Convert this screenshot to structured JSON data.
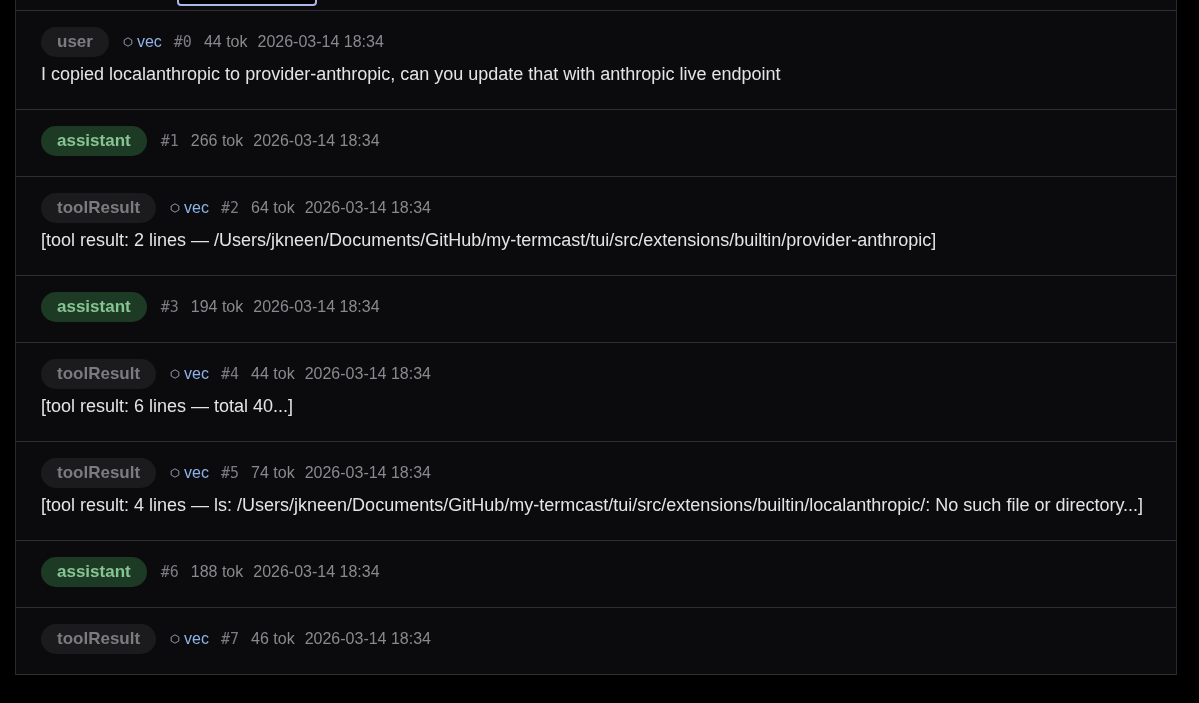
{
  "messages": [
    {
      "kind": "user",
      "role": "user",
      "vec_label": "vec",
      "index": "#0",
      "tokens": "44 tok",
      "time": "2026-03-14 18:34",
      "body": "I copied localanthropic to provider-anthropic, can you update that with anthropic live endpoint"
    },
    {
      "kind": "assistant",
      "role": "assistant",
      "index": "#1",
      "tokens": "266 tok",
      "time": "2026-03-14 18:34"
    },
    {
      "kind": "tool",
      "role": "toolResult",
      "vec_label": "vec",
      "index": "#2",
      "tokens": "64 tok",
      "time": "2026-03-14 18:34",
      "body": "[tool result: 2 lines — /Users/jkneen/Documents/GitHub/my-termcast/tui/src/extensions/builtin/provider-anthropic]"
    },
    {
      "kind": "assistant",
      "role": "assistant",
      "index": "#3",
      "tokens": "194 tok",
      "time": "2026-03-14 18:34"
    },
    {
      "kind": "tool",
      "role": "toolResult",
      "vec_label": "vec",
      "index": "#4",
      "tokens": "44 tok",
      "time": "2026-03-14 18:34",
      "body": "[tool result: 6 lines — total 40...]"
    },
    {
      "kind": "tool",
      "role": "toolResult",
      "vec_label": "vec",
      "index": "#5",
      "tokens": "74 tok",
      "time": "2026-03-14 18:34",
      "body": "[tool result: 4 lines — ls: /Users/jkneen/Documents/GitHub/my-termcast/tui/src/extensions/builtin/localanthropic/: No such file or directory...]"
    },
    {
      "kind": "assistant",
      "role": "assistant",
      "index": "#6",
      "tokens": "188 tok",
      "time": "2026-03-14 18:34"
    },
    {
      "kind": "tool",
      "role": "toolResult",
      "vec_label": "vec",
      "index": "#7",
      "tokens": "46 tok",
      "time": "2026-03-14 18:34"
    }
  ]
}
